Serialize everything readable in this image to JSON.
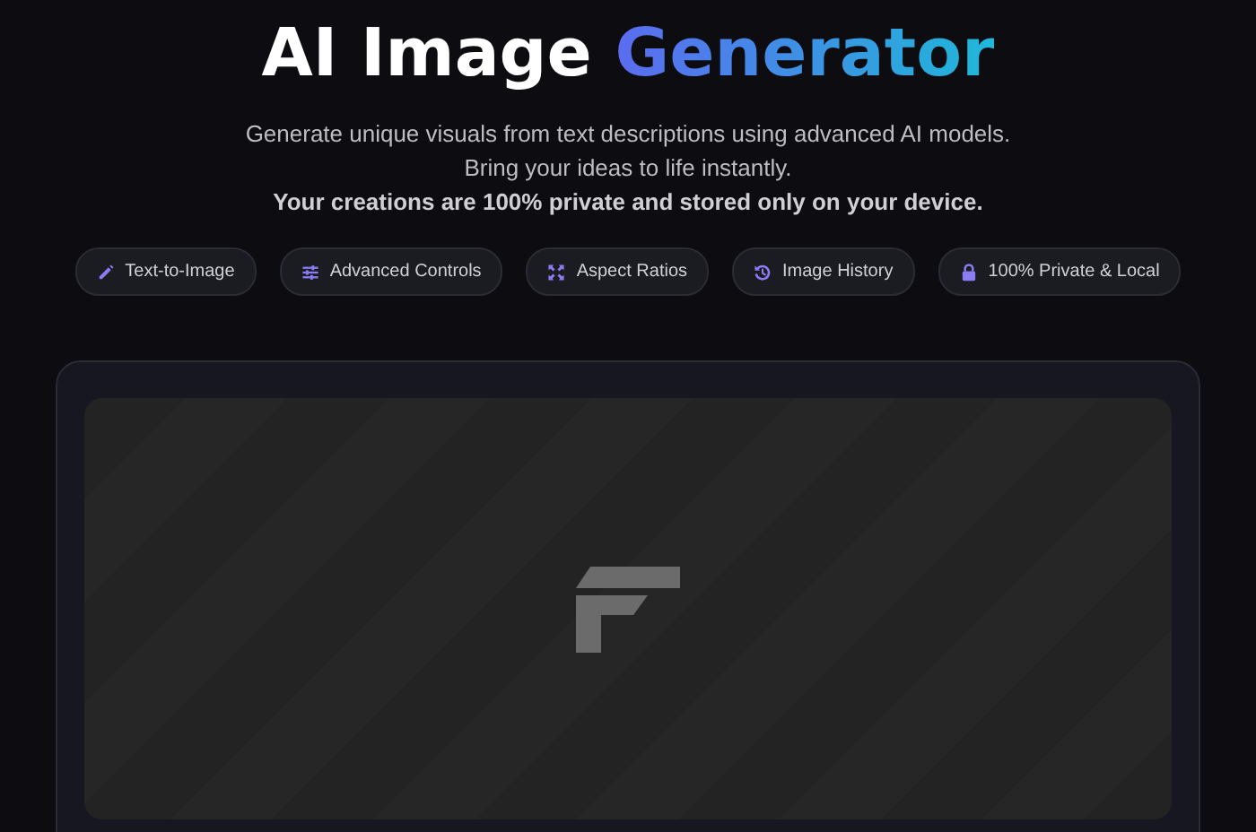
{
  "header": {
    "title": "AI Image",
    "title_accent": "Generator",
    "description": [
      "Generate unique visuals from text descriptions using advanced AI models.",
      "Bring your ideas to life instantly."
    ],
    "privacy_note": "Your creations are 100% private and stored only on your device."
  },
  "features": [
    {
      "kind": "pencil",
      "label": "Text-to-Image"
    },
    {
      "kind": "sliders",
      "label": "Advanced Controls"
    },
    {
      "kind": "expand",
      "label": "Aspect Ratios"
    },
    {
      "kind": "history",
      "label": "Image History"
    },
    {
      "kind": "lock",
      "label": "100% Private & Local"
    }
  ],
  "preview": {
    "kind": "placeholder"
  }
}
